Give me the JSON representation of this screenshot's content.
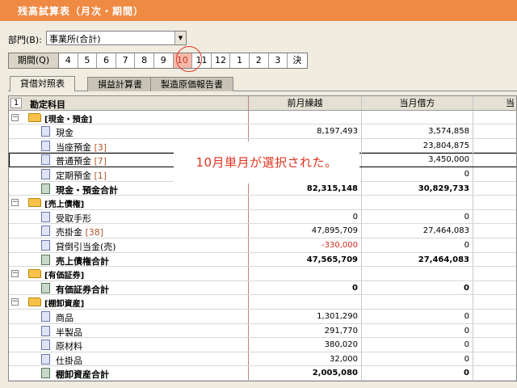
{
  "window": {
    "title": "残高試算表（月次・期間）"
  },
  "department": {
    "label": "部門(B):",
    "value": "事業所(合計)"
  },
  "period": {
    "label": "期間(Q)",
    "months": [
      "4",
      "5",
      "6",
      "7",
      "8",
      "9",
      "10",
      "11",
      "12",
      "1",
      "2",
      "3",
      "決"
    ],
    "selected": "10"
  },
  "tabs": [
    "貸借対照表",
    "損益計算書",
    "製造原価報告書"
  ],
  "table": {
    "columns": [
      "勘定科目",
      "前月繰越",
      "当月借方",
      "当"
    ],
    "row_no": "1",
    "rows": [
      {
        "type": "cat",
        "name": "[現金・預金]",
        "c1": "",
        "c2": ""
      },
      {
        "type": "item",
        "name": "現金",
        "code": "",
        "c1": "8,197,493",
        "c2": "3,574,858"
      },
      {
        "type": "item",
        "name": "当座預金",
        "code": "[3]",
        "c1": "",
        "c2": "23,804,875"
      },
      {
        "type": "item",
        "name": "普通預金",
        "code": "[7]",
        "c1": "",
        "c2": "3,450,000",
        "selected": true
      },
      {
        "type": "item",
        "name": "定期預金",
        "code": "[1]",
        "c1": "",
        "c2": "0"
      },
      {
        "type": "total",
        "name": "現金・預金合計",
        "c1": "82,315,148",
        "c2": "30,829,733"
      },
      {
        "type": "cat",
        "name": "[売上債権]",
        "c1": "",
        "c2": ""
      },
      {
        "type": "item",
        "name": "受取手形",
        "code": "",
        "c1": "0",
        "c2": "0"
      },
      {
        "type": "item",
        "name": "売掛金",
        "code": "[38]",
        "c1": "47,895,709",
        "c2": "27,464,083"
      },
      {
        "type": "item",
        "name": "貸倒引当金(売)",
        "code": "",
        "c1": "-330,000",
        "c2": "0",
        "negative": true
      },
      {
        "type": "total",
        "name": "売上債権合計",
        "c1": "47,565,709",
        "c2": "27,464,083"
      },
      {
        "type": "cat",
        "name": "[有価証券]",
        "c1": "",
        "c2": ""
      },
      {
        "type": "total",
        "name": "有価証券合計",
        "c1": "0",
        "c2": "0"
      },
      {
        "type": "cat",
        "name": "[棚卸資産]",
        "c1": "",
        "c2": ""
      },
      {
        "type": "item",
        "name": "商品",
        "code": "",
        "c1": "1,301,290",
        "c2": "0"
      },
      {
        "type": "item",
        "name": "半製品",
        "code": "",
        "c1": "291,770",
        "c2": "0"
      },
      {
        "type": "item",
        "name": "原材料",
        "code": "",
        "c1": "380,020",
        "c2": "0"
      },
      {
        "type": "item",
        "name": "仕掛品",
        "code": "",
        "c1": "32,000",
        "c2": "0"
      },
      {
        "type": "total",
        "name": "棚卸資産合計",
        "c1": "2,005,080",
        "c2": "0"
      }
    ]
  },
  "callout": "10月単月が選択された。"
}
